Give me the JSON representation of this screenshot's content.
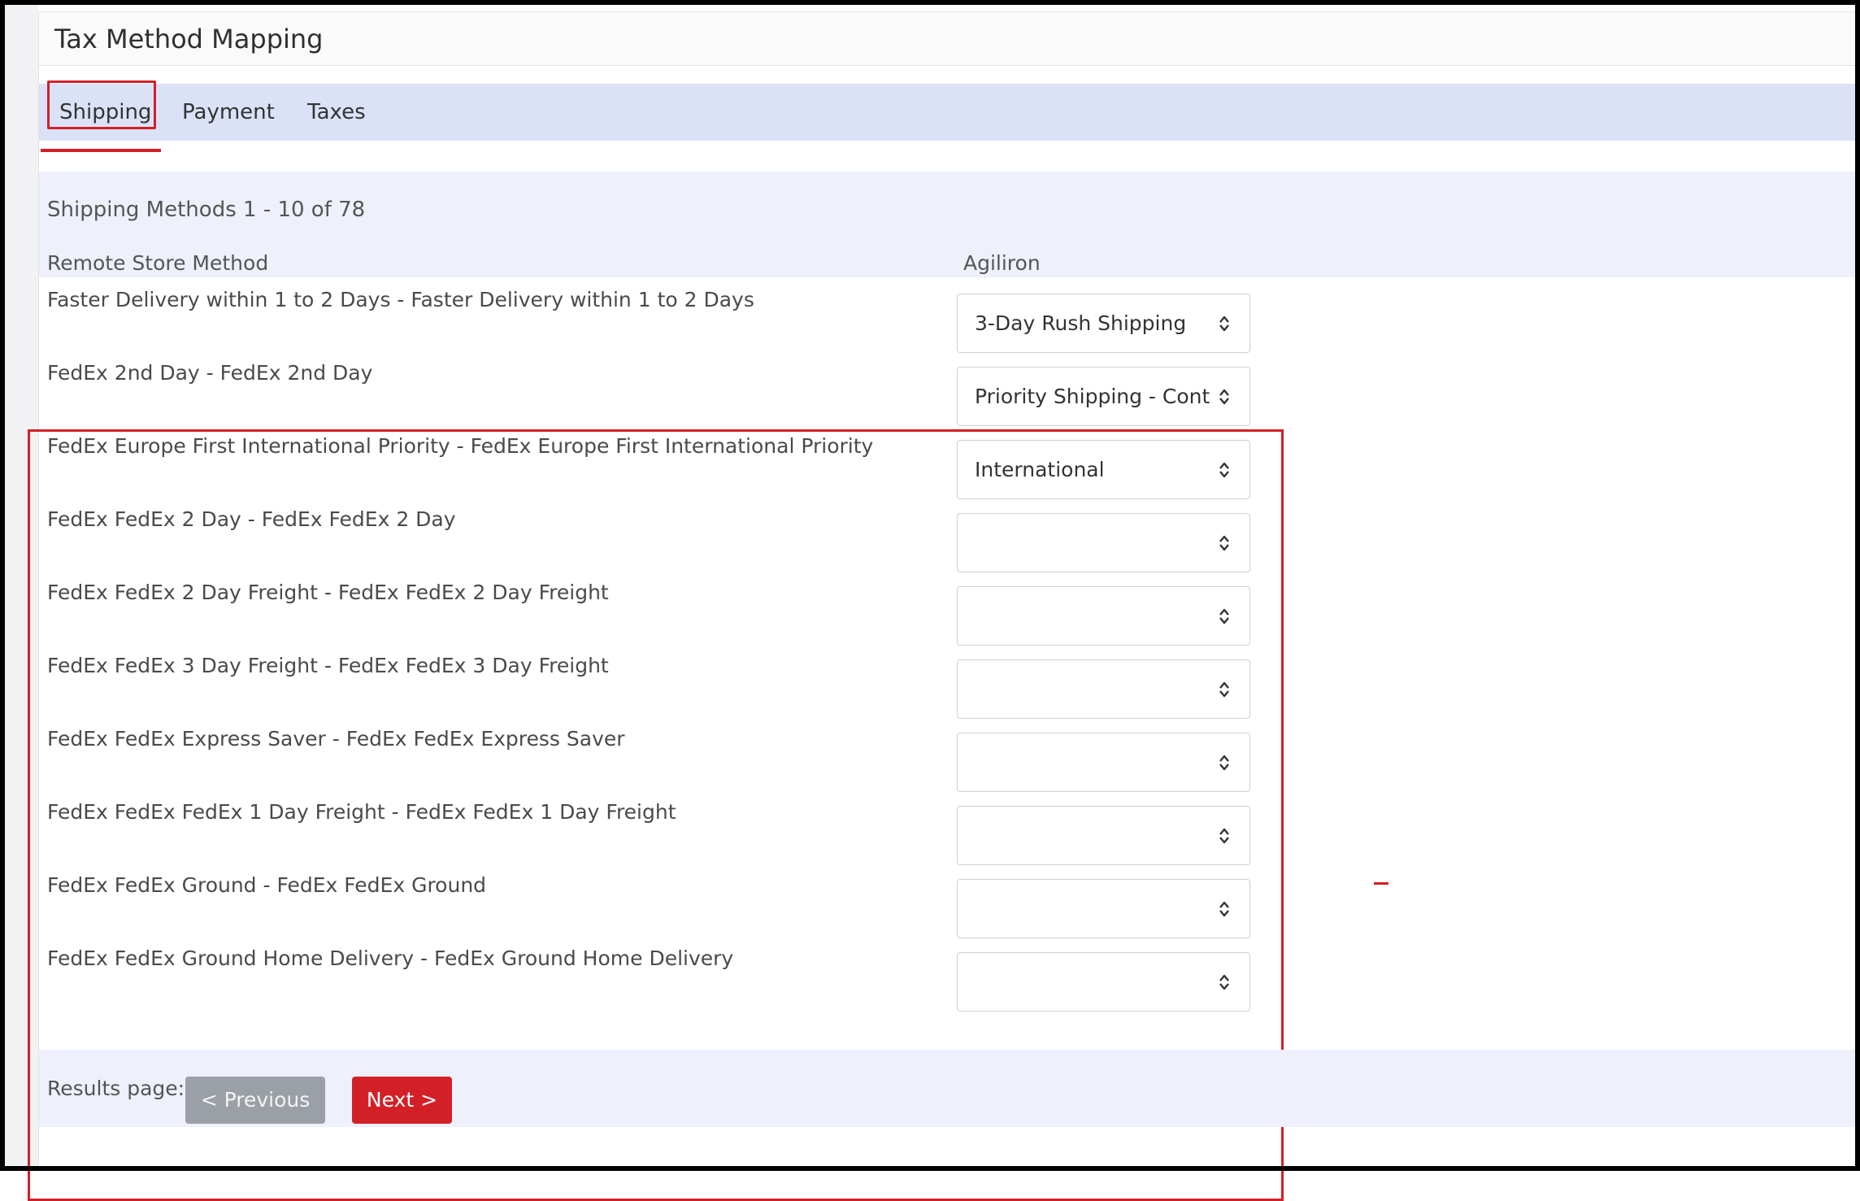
{
  "page": {
    "title": "Tax Method Mapping"
  },
  "tabs": [
    {
      "label": "Shipping",
      "active": true
    },
    {
      "label": "Payment",
      "active": false
    },
    {
      "label": "Taxes",
      "active": false
    }
  ],
  "shipping": {
    "count_text": "Shipping Methods 1 - 10 of 78",
    "columns": {
      "remote": "Remote Store Method",
      "agiliron": "Agiliron"
    },
    "rows": [
      {
        "label": "Faster Delivery within 1 to 2 Days - Faster Delivery within 1 to 2 Days",
        "value": "3-Day Rush Shipping"
      },
      {
        "label": "FedEx 2nd Day - FedEx 2nd Day",
        "value": "Priority Shipping - Conti"
      },
      {
        "label": "FedEx Europe First International Priority - FedEx Europe First International Priority",
        "value": "International"
      },
      {
        "label": "FedEx FedEx 2 Day - FedEx FedEx 2 Day",
        "value": ""
      },
      {
        "label": "FedEx FedEx 2 Day Freight - FedEx FedEx 2 Day Freight",
        "value": ""
      },
      {
        "label": "FedEx FedEx 3 Day Freight - FedEx FedEx 3 Day Freight",
        "value": ""
      },
      {
        "label": "FedEx FedEx Express Saver - FedEx FedEx Express Saver",
        "value": ""
      },
      {
        "label": "FedEx FedEx FedEx 1 Day Freight - FedEx FedEx 1 Day Freight",
        "value": ""
      },
      {
        "label": "FedEx FedEx Ground - FedEx FedEx Ground",
        "value": ""
      },
      {
        "label": "FedEx FedEx Ground Home Delivery - FedEx Ground Home Delivery",
        "value": ""
      }
    ]
  },
  "pager": {
    "label": "Results page:",
    "previous": "< Previous",
    "next": "Next >"
  },
  "icons": {
    "select_arrows": "up-down-chevron-icon"
  },
  "colors": {
    "accent": "#d32026",
    "tab_bar": "#dbe2f8",
    "band": "#eef1fc",
    "disabled_button": "#9aa0a6"
  }
}
